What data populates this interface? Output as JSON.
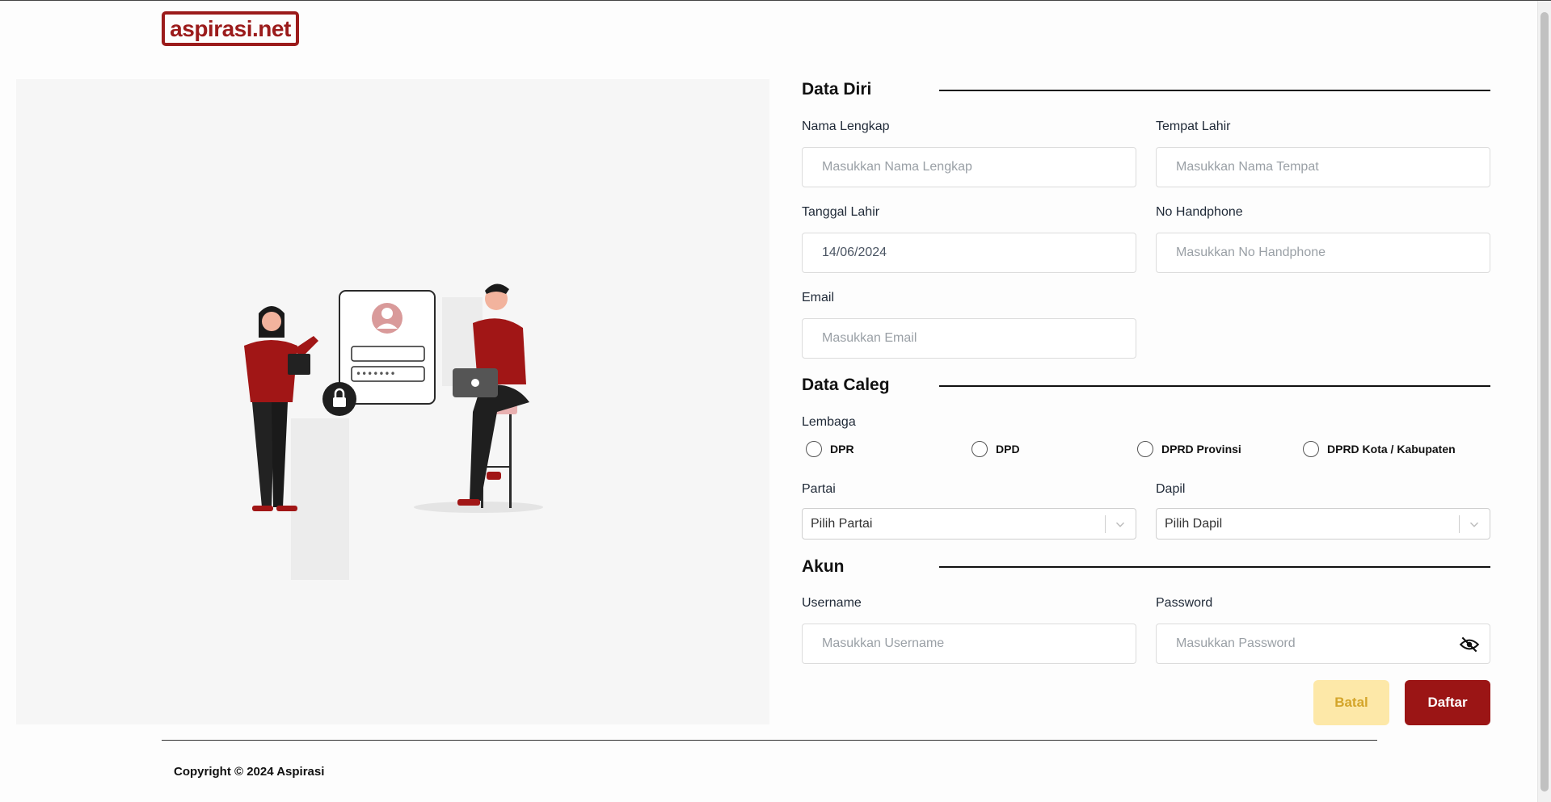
{
  "brand": {
    "logo_text": "aspirasi.net",
    "color": "#9b1b1b"
  },
  "sections": {
    "data_diri": "Data Diri",
    "data_caleg": "Data Caleg",
    "akun": "Akun"
  },
  "fields": {
    "nama_lengkap": {
      "label": "Nama Lengkap",
      "placeholder": "Masukkan Nama Lengkap"
    },
    "tempat_lahir": {
      "label": "Tempat Lahir",
      "placeholder": "Masukkan Nama Tempat"
    },
    "tanggal_lahir": {
      "label": "Tanggal Lahir",
      "value": "14/06/2024"
    },
    "no_handphone": {
      "label": "No Handphone",
      "placeholder": "Masukkan No Handphone"
    },
    "email": {
      "label": "Email",
      "placeholder": "Masukkan Email"
    },
    "username": {
      "label": "Username",
      "placeholder": "Masukkan Username"
    },
    "password": {
      "label": "Password",
      "placeholder": "Masukkan Password"
    }
  },
  "lembaga": {
    "label": "Lembaga",
    "options": [
      "DPR",
      "DPD",
      "DPRD Provinsi",
      "DPRD Kota / Kabupaten"
    ]
  },
  "partai": {
    "label": "Partai",
    "selected": "Pilih Partai"
  },
  "dapil": {
    "label": "Dapil",
    "selected": "Pilih Dapil"
  },
  "buttons": {
    "cancel": "Batal",
    "submit": "Daftar"
  },
  "footer": {
    "copyright": "Copyright © 2024 Aspirasi"
  },
  "colors": {
    "primary": "#9b1515",
    "cancel_bg": "#fde8a8",
    "cancel_text": "#d4a52a",
    "panel_bg": "#f6f6f6"
  },
  "illustration": {
    "login_password_mask": "•••••••"
  }
}
